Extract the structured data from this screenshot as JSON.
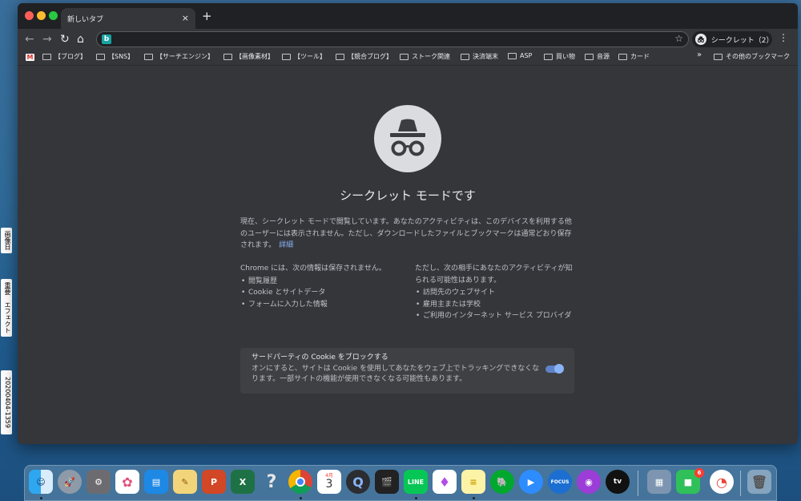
{
  "desktop": {
    "labels": [
      "画像日",
      "重要　エフェクト",
      "20200404-1359"
    ]
  },
  "browser": {
    "tab": {
      "title": "新しいタブ",
      "close": "×"
    },
    "new_tab": "+",
    "nav": {
      "back": "←",
      "forward": "→",
      "reload": "↻",
      "home": "⌂"
    },
    "omnibox": {
      "value": "",
      "search_engine": "b"
    },
    "profile": {
      "label": "シークレット（2）"
    },
    "menu": "⋮",
    "bookmarks": [
      "【ブログ】",
      "【SNS】",
      "【サーチエンジン】",
      "【画像素材】",
      "【ツール】",
      "【競合ブログ】",
      "ストーク関連",
      "決済端末",
      "ASP",
      "買い物",
      "音源",
      "カード"
    ],
    "bookmarks_overflow": "»",
    "other_bookmarks": "その他のブックマーク"
  },
  "page": {
    "headline": "シークレット モードです",
    "intro": "現在、シークレット モードで閲覧しています。あなたのアクティビティは、このデバイスを利用する他のユーザーには表示されません。ただし、ダウンロードしたファイルとブックマークは通常どおり保存されます。",
    "details_link": "詳細",
    "not_saved": {
      "heading": "Chrome には、次の情報は保存されません。",
      "items": [
        "閲覧履歴",
        "Cookie とサイトデータ",
        "フォームに入力した情報"
      ]
    },
    "may_be_visible": {
      "heading": "ただし、次の相手にあなたのアクティビティが知られる可能性はあります。",
      "items": [
        "訪問先のウェブサイト",
        "雇用主または学校",
        "ご利用のインターネット サービス プロバイダ"
      ]
    },
    "cookie_block": {
      "title": "サードパーティの Cookie をブロックする",
      "description": "オンにすると、サイトは Cookie を使用してあなたをウェブ上でトラッキングできなくなります。一部サイトの機能が使用できなくなる可能性もあります。",
      "enabled": true
    }
  },
  "dock": {
    "calendar_date": "3",
    "calendar_month": "4月",
    "line_label": "LINE",
    "focus_label": "FOCUS",
    "tv_label": "tv",
    "facetime_badge": "6"
  }
}
